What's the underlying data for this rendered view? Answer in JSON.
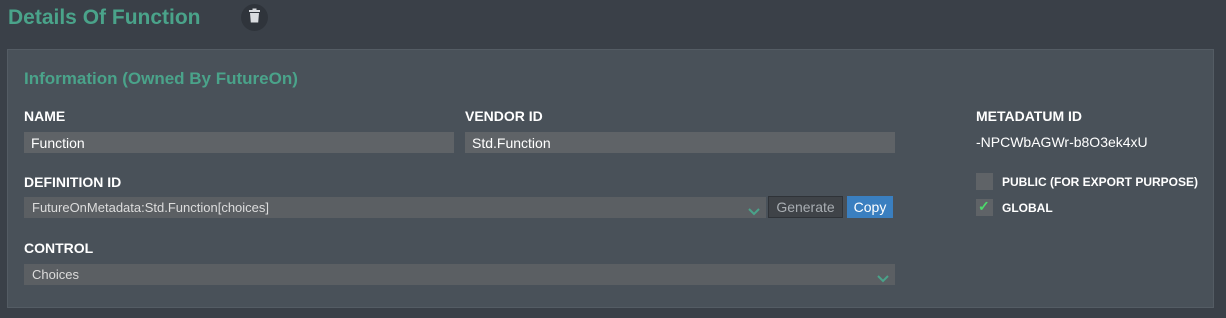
{
  "header": {
    "title": "Details Of Function"
  },
  "info": {
    "title": "Information (Owned By FutureOn)",
    "name_label": "NAME",
    "name_value": "Function",
    "vendor_label": "VENDOR ID",
    "vendor_value": "Std.Function",
    "definition_label": "DEFINITION ID",
    "definition_value": "FutureOnMetadata:Std.Function[choices]",
    "generate_label": "Generate",
    "copy_label": "Copy",
    "control_label": "CONTROL",
    "control_value": "Choices",
    "metadatum_label": "METADATUM ID",
    "metadatum_value": "-NPCWbAGWr-b8O3ek4xU",
    "public_label": "PUBLIC (FOR EXPORT PURPOSE)",
    "public_checked": false,
    "global_label": "GLOBAL",
    "global_checked": true
  },
  "colors": {
    "accent": "#4aa38a",
    "primary_button": "#3a7fc0",
    "check": "#4cd96b"
  },
  "icons": {
    "delete": "trash-icon",
    "dropdown": "chevron-down-icon",
    "check": "check-icon"
  }
}
